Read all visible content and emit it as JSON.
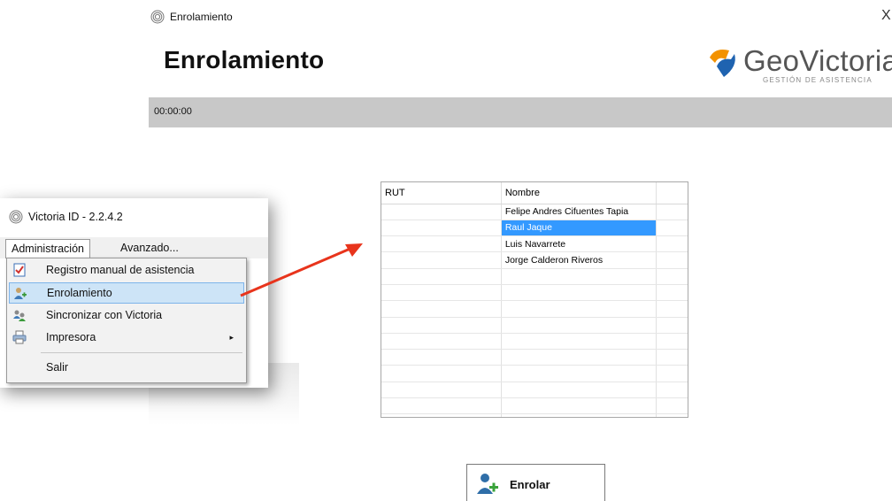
{
  "window": {
    "title": "Enrolamiento",
    "close_glyph": "X",
    "heading": "Enrolamiento"
  },
  "logo": {
    "word": "GeoVictoria",
    "tagline": "GESTIÓN DE ASISTENCIA",
    "colors": {
      "orange": "#f39200",
      "blue": "#1f63b0"
    }
  },
  "timer": {
    "value": "00:00:00"
  },
  "grid": {
    "headers": [
      "RUT",
      "Nombre"
    ],
    "rows": [
      {
        "rut": "",
        "nombre": "Felipe Andres Cifuentes Tapia"
      },
      {
        "rut": "",
        "nombre": "Raul Jaque",
        "selected": true
      },
      {
        "rut": "",
        "nombre": "Luis  Navarrete"
      },
      {
        "rut": "",
        "nombre": "Jorge  Calderon Riveros"
      }
    ],
    "selection_color": "#3399ff"
  },
  "popup": {
    "title": "Victoria ID - 2.2.4.2",
    "menus": [
      "Administración",
      "Avanzado..."
    ],
    "items": [
      {
        "label": "Registro manual de asistencia",
        "icon": "checklist-icon"
      },
      {
        "label": "Enrolamiento",
        "icon": "user-add-icon",
        "highlighted": true
      },
      {
        "label": "Sincronizar con Victoria",
        "icon": "sync-users-icon"
      },
      {
        "label": "Impresora",
        "icon": "printer-icon",
        "submenu": "▸"
      },
      {
        "label": "Salir",
        "icon": ""
      }
    ]
  },
  "annotation_arrow_color": "#e8341c",
  "button": {
    "label": "Enrolar",
    "icon": "user-add-icon"
  }
}
